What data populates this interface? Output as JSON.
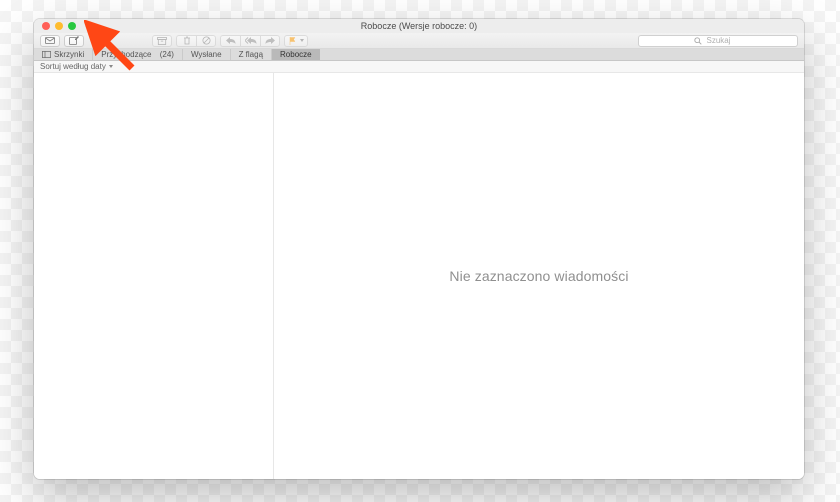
{
  "window": {
    "title": "Robocze (Wersje robocze: 0)"
  },
  "toolbar": {
    "inbox_btn": "get-mail-button",
    "compose_btn": "compose-button",
    "archive_btn": "archive-button",
    "delete_btn": "delete-button",
    "junk_btn": "junk-button",
    "reply_btn": "reply-button",
    "reply_all_btn": "reply-all-button",
    "forward_btn": "forward-button",
    "flag_btn": "flag-button"
  },
  "search": {
    "placeholder": "Szukaj"
  },
  "tabs": {
    "mailboxes": "Skrzynki",
    "inbox_label": "Przychodzące",
    "inbox_count": "(24)",
    "sent": "Wysłane",
    "flagged": "Z flagą",
    "drafts": "Robocze"
  },
  "sort": {
    "label": "Sortuj według daty"
  },
  "message_pane": {
    "empty": "Nie zaznaczono wiadomości"
  }
}
